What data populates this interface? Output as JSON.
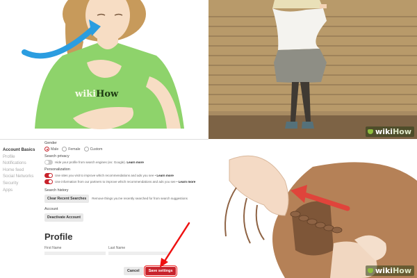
{
  "watermark": {
    "wiki": "wiki",
    "how": "How"
  },
  "shirt_logo": {
    "wiki": "wiki",
    "how": "How"
  },
  "settings": {
    "sidebar": [
      "Account Basics",
      "Profile",
      "Notifications",
      "Home feed",
      "Social Networks",
      "Security",
      "Apps"
    ],
    "gender": {
      "label": "Gender",
      "options": [
        "Male",
        "Female",
        "Custom"
      ],
      "selected": "Male"
    },
    "search_privacy": {
      "label": "Search privacy",
      "option": "Hide your profile from search engines (ex: Google).",
      "learn_more": "Learn more",
      "enabled": false
    },
    "personalization": {
      "label": "Personalization",
      "options": [
        {
          "text": "Use sites you visit to improve which recommendations and ads you see •",
          "learn_more": "Learn more",
          "enabled": true
        },
        {
          "text": "Use information from our partners to improve which recommendations and ads you see •",
          "learn_more": "Learn more",
          "enabled": true
        }
      ]
    },
    "search_history": {
      "label": "Search history",
      "button": "Clear Recent Searches",
      "desc": "Remove things you've recently searched for from search suggestions"
    },
    "account": {
      "label": "Account",
      "button": "Deactivate Account"
    },
    "profile": {
      "heading": "Profile",
      "first_name": "First Name",
      "last_name": "Last Name"
    },
    "footer": {
      "cancel": "Cancel",
      "save": "Save settings"
    },
    "accent_color": "#c8232c"
  }
}
